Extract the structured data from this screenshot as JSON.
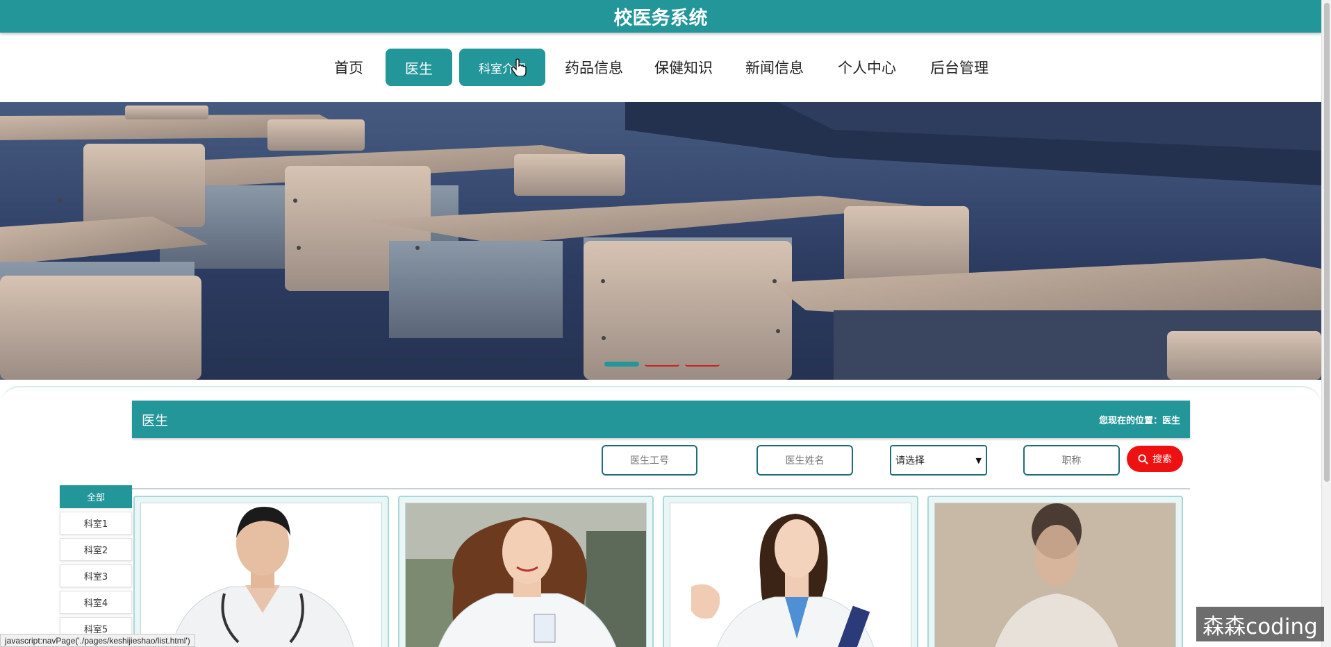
{
  "app": {
    "title": "校医务系统"
  },
  "nav": [
    {
      "label": "首页",
      "active": false
    },
    {
      "label": "医生",
      "active": true
    },
    {
      "label": "科室介绍",
      "active": true
    },
    {
      "label": "药品信息",
      "active": false
    },
    {
      "label": "保健知识",
      "active": false
    },
    {
      "label": "新闻信息",
      "active": false
    },
    {
      "label": "个人中心",
      "active": false
    },
    {
      "label": "后台管理",
      "active": false
    }
  ],
  "banner": {
    "slides": 3,
    "current": 1
  },
  "section": {
    "title": "医生",
    "breadcrumb_prefix": "您现在的位置：",
    "breadcrumb_current": "医生"
  },
  "search": {
    "doctor_id_placeholder": "医生工号",
    "doctor_name_placeholder": "医生姓名",
    "select_value": "请选择",
    "title_placeholder": "职称",
    "button_label": "搜索"
  },
  "departments": [
    {
      "label": "全部",
      "active": true
    },
    {
      "label": "科室1",
      "active": false
    },
    {
      "label": "科室2",
      "active": false
    },
    {
      "label": "科室3",
      "active": false
    },
    {
      "label": "科室4",
      "active": false
    },
    {
      "label": "科室5",
      "active": false
    }
  ],
  "status_bar": "javascript:navPage('./pages/keshijieshao/list.html')",
  "watermark": "森森coding",
  "colors": {
    "primary": "#23969a",
    "search_button": "#ee1111",
    "field_border": "#1f6d78"
  }
}
